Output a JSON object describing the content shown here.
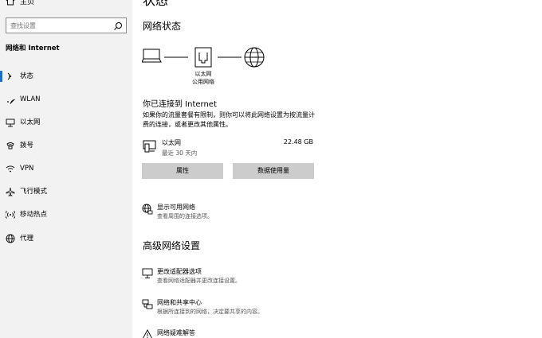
{
  "sidebar": {
    "home_label": "主页",
    "search_placeholder": "查找设置",
    "section_title": "网络和 Internet",
    "items": [
      {
        "label": "状态",
        "icon": "status-icon",
        "active": true
      },
      {
        "label": "WLAN",
        "icon": "wifi-icon"
      },
      {
        "label": "以太网",
        "icon": "ethernet-icon"
      },
      {
        "label": "拨号",
        "icon": "dialup-icon"
      },
      {
        "label": "VPN",
        "icon": "vpn-icon"
      },
      {
        "label": "飞行模式",
        "icon": "airplane-icon"
      },
      {
        "label": "移动热点",
        "icon": "hotspot-icon"
      },
      {
        "label": "代理",
        "icon": "globe-icon"
      }
    ]
  },
  "main": {
    "page_title": "状态",
    "network_status_heading": "网络状态",
    "diagram": {
      "device_label": "以太网",
      "network_label": "公用网络"
    },
    "connected_title": "你已连接到 Internet",
    "connected_desc": "如果你的流量套餐有限制，则你可以将此网络设置为按流量计费的连接，或者更改其他属性。",
    "adapter": {
      "name": "以太网",
      "period": "最近 30 天内",
      "usage": "22.48 GB"
    },
    "buttons": {
      "properties": "属性",
      "data_usage": "数据使用量"
    },
    "show_networks": {
      "title": "显示可用网络",
      "desc": "查看周围的连接选项。"
    },
    "advanced_heading": "高级网络设置",
    "advanced_items": [
      {
        "title": "更改适配器选项",
        "desc": "查看网络适配器并更改连接设置。",
        "icon": "adapter-icon"
      },
      {
        "title": "网络和共享中心",
        "desc": "根据所连接到的网络，决定要共享的内容。",
        "icon": "sharing-icon"
      },
      {
        "title": "网络疑难解答",
        "desc": "",
        "icon": "warning-icon"
      }
    ]
  },
  "colors": {
    "sidebar_bg": "#f2f2f2",
    "accent": "#0078d7",
    "button_bg": "#cccccc"
  }
}
